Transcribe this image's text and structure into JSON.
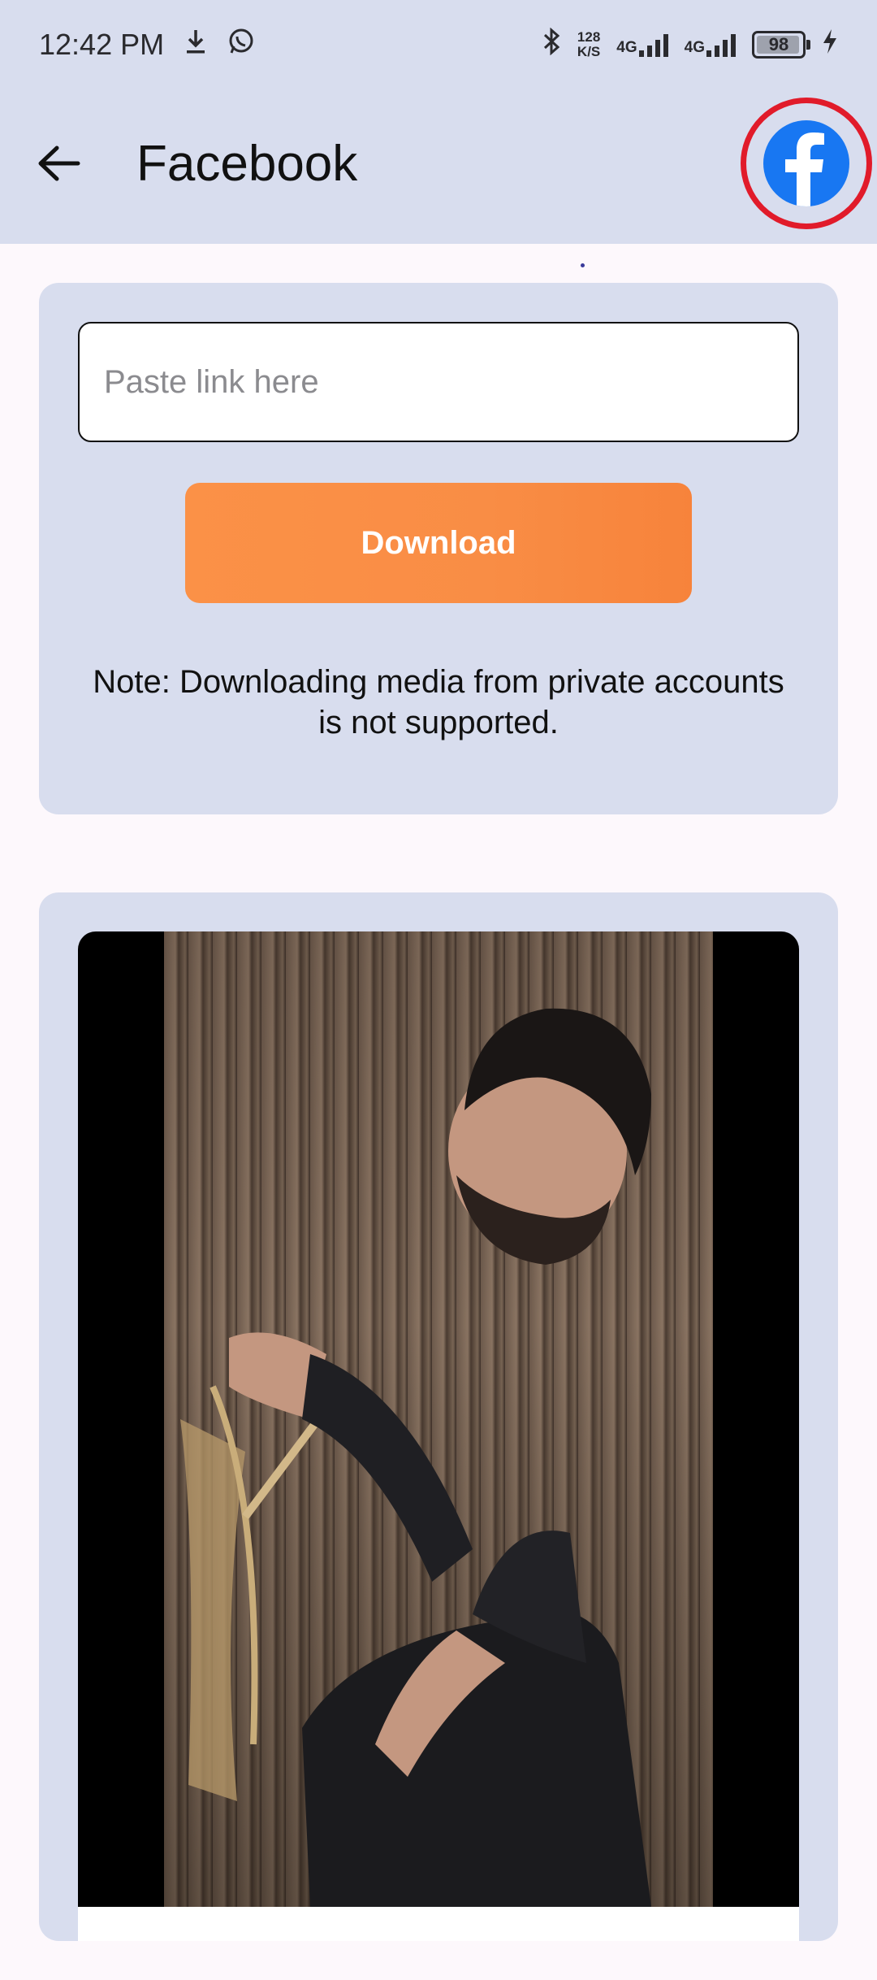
{
  "status_bar": {
    "time": "12:42 PM",
    "speed_value": "128",
    "speed_unit": "K/S",
    "network1": "4G",
    "network2": "4G",
    "battery": "98"
  },
  "toolbar": {
    "title": "Facebook",
    "logo_letter": "f"
  },
  "form": {
    "input_placeholder": "Paste link here",
    "input_value": "",
    "download_label": "Download",
    "note": "Note: Downloading media from private accounts is not supported."
  },
  "colors": {
    "app_bar": "#d8ddee",
    "accent_button": "#fb9147",
    "facebook_blue": "#1877f2",
    "highlight_ring": "#e11b2a"
  }
}
